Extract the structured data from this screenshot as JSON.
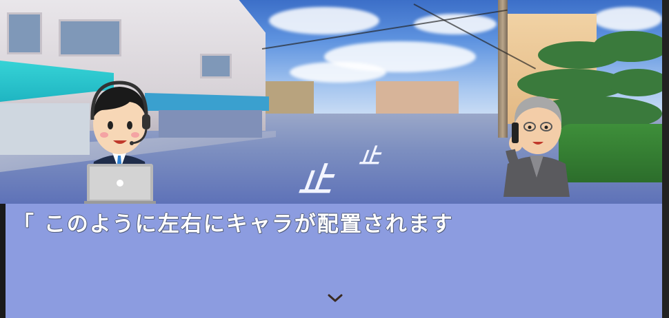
{
  "scene": {
    "name": "street-background",
    "road_marking": "止まれ",
    "road_marking_top": "止"
  },
  "characters": {
    "left": {
      "name": "operator-with-headset",
      "icon": "operator-headset-laptop"
    },
    "right": {
      "name": "elderly-man-on-phone",
      "icon": "elderly-man-phone"
    }
  },
  "message": {
    "text": "「 このように左右にキャラが配置されます",
    "advance_icon": "chevron-down-icon"
  },
  "colors": {
    "message_window": "#8c9ce0",
    "message_text": "#ffffff",
    "advance_icon": "#3a2a22"
  }
}
